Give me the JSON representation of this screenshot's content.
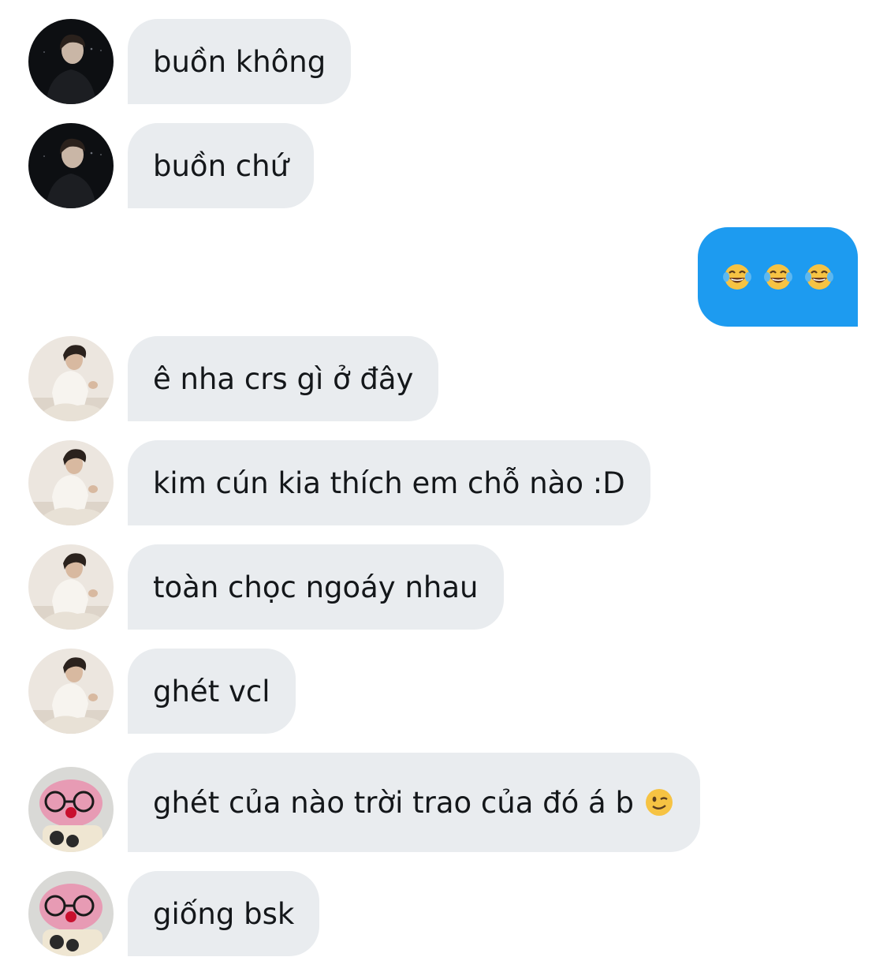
{
  "conversation": {
    "messages": [
      {
        "sender": "dark-portrait",
        "direction": "incoming",
        "text": "buồn không"
      },
      {
        "sender": "dark-portrait",
        "direction": "incoming",
        "text": "buồn chứ"
      },
      {
        "sender": "me",
        "direction": "outgoing",
        "text": "😂😂😂"
      },
      {
        "sender": "white-outfit",
        "direction": "incoming",
        "text": "ê nha crs gì ở đây"
      },
      {
        "sender": "white-outfit",
        "direction": "incoming",
        "text": "kim cún kia thích em chỗ nào :D"
      },
      {
        "sender": "white-outfit",
        "direction": "incoming",
        "text": "toàn chọc ngoáy nhau"
      },
      {
        "sender": "white-outfit",
        "direction": "incoming",
        "text": "ghét vcl"
      },
      {
        "sender": "pink-plush",
        "direction": "incoming",
        "text": "ghét của nào trời trao của đó á b",
        "trailing_emoji": "😉"
      },
      {
        "sender": "pink-plush",
        "direction": "incoming",
        "text": "giống bsk"
      }
    ]
  },
  "colors": {
    "incoming_bubble": "#e9ecef",
    "outgoing_bubble": "#1d9bf0",
    "text": "#14171a"
  },
  "icons": {
    "laugh": "face-with-tears-of-joy-icon",
    "wink": "winking-face-icon"
  }
}
